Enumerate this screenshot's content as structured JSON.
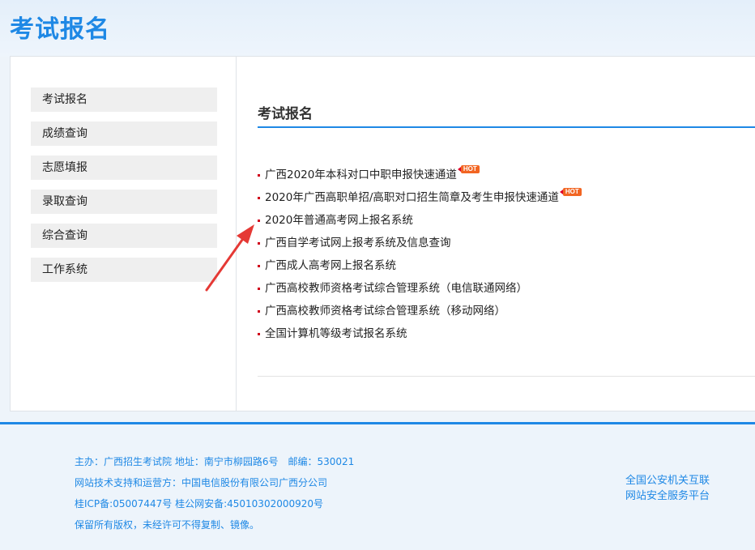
{
  "header": {
    "title": "考试报名"
  },
  "sidebar": {
    "items": [
      {
        "label": "考试报名"
      },
      {
        "label": "成绩查询"
      },
      {
        "label": "志愿填报"
      },
      {
        "label": "录取查询"
      },
      {
        "label": "综合查询"
      },
      {
        "label": "工作系统"
      }
    ]
  },
  "content": {
    "title": "考试报名",
    "links": [
      {
        "label": "广西2020年本科对口中职申报快速通道",
        "badge": "HOT"
      },
      {
        "label": "2020年广西高职单招/高职对口招生简章及考生申报快速通道",
        "badge": "HOT"
      },
      {
        "label": "2020年普通高考网上报名系统"
      },
      {
        "label": "广西自学考试网上报考系统及信息查询"
      },
      {
        "label": "广西成人高考网上报名系统"
      },
      {
        "label": "广西高校教师资格考试综合管理系统（电信联通网络）"
      },
      {
        "label": "广西高校教师资格考试综合管理系统（移动网络）"
      },
      {
        "label": "全国计算机等级考试报名系统"
      }
    ]
  },
  "colors": {
    "accent": "#1e88e5",
    "hot": "#f26522",
    "arrow": "#e53935",
    "bullet": "#d0021b"
  },
  "footer": {
    "line1": "主办：广西招生考试院 地址：南宁市柳园路6号　邮编：530021",
    "line2": "网站技术支持和运营方：中国电信股份有限公司广西分公司",
    "line3": "桂ICP备:05007447号 桂公网安备:45010302000920号",
    "line4": "保留所有版权，未经许可不得复制、镜像。",
    "police_line1": "全国公安机关互联",
    "police_line2": "网站安全服务平台"
  }
}
